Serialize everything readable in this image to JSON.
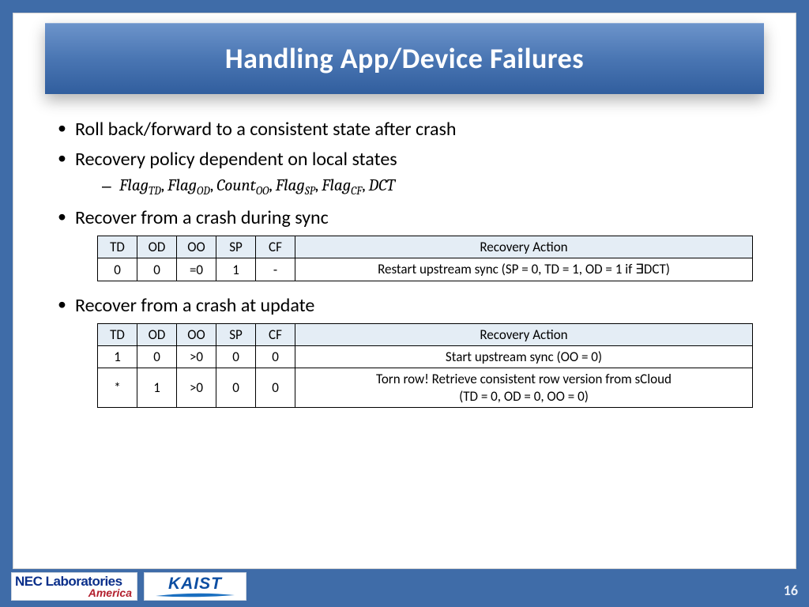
{
  "title": "Handling App/Device Failures",
  "bullets": {
    "b1": "Roll back/forward to a consistent state after crash",
    "b2": "Recovery policy dependent on local states",
    "b3": "Recover from a crash during sync",
    "b4": "Recover from a crash at update"
  },
  "flags_line_parts": {
    "flag": "Flag",
    "count": "Count",
    "dct": "DCT",
    "td": "TD",
    "od": "OD",
    "oo": "OO",
    "sp": "SP",
    "cf": "CF",
    "comma": ", "
  },
  "table_headers": {
    "td": "TD",
    "od": "OD",
    "oo": "OO",
    "sp": "SP",
    "cf": "CF",
    "action": "Recovery Action"
  },
  "table_sync": {
    "rows": [
      {
        "td": "0",
        "od": "0",
        "oo": "=0",
        "sp": "1",
        "cf": "-",
        "action": "Restart upstream sync (SP = 0, TD = 1, OD = 1 if ∃DCT)"
      }
    ]
  },
  "table_update": {
    "rows": [
      {
        "td": "1",
        "od": "0",
        "oo": ">0",
        "sp": "0",
        "cf": "0",
        "action": "Start upstream sync (OO = 0)"
      },
      {
        "td": "*",
        "od": "1",
        "oo": ">0",
        "sp": "0",
        "cf": "0",
        "action": "Torn row! Retrieve consistent row version from sCloud\n(TD = 0, OD = 0, OO = 0)"
      }
    ]
  },
  "logos": {
    "nec_top": "NEC Laboratories",
    "nec_bottom": "America",
    "kaist": "KAIST"
  },
  "page_number": "16"
}
